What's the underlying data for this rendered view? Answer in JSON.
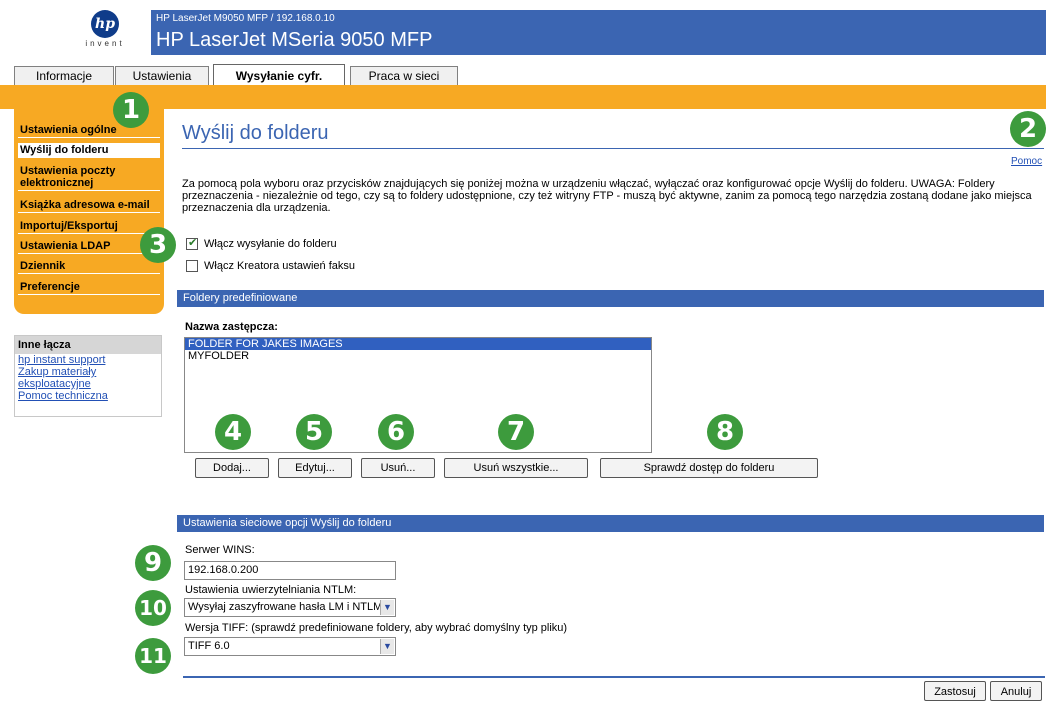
{
  "header": {
    "logo_text": "invent",
    "device_small": "HP LaserJet M9050 MFP / 192.168.0.10",
    "device_title": "HP LaserJet MSeria 9050 MFP"
  },
  "tabs": [
    {
      "label": "Informacje"
    },
    {
      "label": "Ustawienia"
    },
    {
      "label": "Wysyłanie cyfr."
    },
    {
      "label": "Praca w sieci"
    }
  ],
  "sidebar": {
    "items": [
      {
        "label": "Ustawienia ogólne"
      },
      {
        "label": "Wyślij do folderu"
      },
      {
        "label": "Ustawienia poczty elektronicznej"
      },
      {
        "label": "Książka adresowa e-mail"
      },
      {
        "label": "Importuj/Eksportuj"
      },
      {
        "label": "Ustawienia LDAP"
      },
      {
        "label": "Dziennik"
      },
      {
        "label": "Preferencje"
      }
    ]
  },
  "links": {
    "title": "Inne łącza",
    "items": [
      {
        "label": "hp instant support"
      },
      {
        "label": "Zakup materiały eksploatacyjne"
      },
      {
        "label": "Pomoc techniczna"
      }
    ]
  },
  "main": {
    "title": "Wyślij do folderu",
    "help": "Pomoc",
    "description": "Za pomocą pola wyboru oraz przycisków znajdujących się poniżej można w urządzeniu włączać, wyłączać oraz konfigurować opcje Wyślij do folderu. UWAGA: Foldery przeznaczenia - niezależnie od tego, czy są to foldery udostępnione, czy też witryny FTP - muszą być aktywne, zanim za pomocą tego narzędzia zostaną dodane jako miejsca przeznaczenia dla urządzenia.",
    "checkbox_folder": "Włącz wysyłanie do folderu",
    "checkbox_folder_checked": true,
    "checkbox_fax": "Włącz Kreatora ustawień faksu",
    "checkbox_fax_checked": false
  },
  "predefined": {
    "section_title": "Foldery predefiniowane",
    "list_label": "Nazwa zastępcza:",
    "items": [
      {
        "label": "FOLDER FOR JAKES IMAGES",
        "selected": true
      },
      {
        "label": "MYFOLDER",
        "selected": false
      }
    ],
    "buttons": {
      "add": "Dodaj...",
      "edit": "Edytuj...",
      "delete": "Usuń...",
      "delete_all": "Usuń wszystkie...",
      "check_access": "Sprawdź dostęp do folderu"
    }
  },
  "network": {
    "section_title": "Ustawienia sieciowe opcji Wyślij do folderu",
    "wins_label": "Serwer WINS:",
    "wins_value": "192.168.0.200",
    "ntlm_label": "Ustawienia uwierzytelniania NTLM:",
    "ntlm_value": "Wysyłaj zaszyfrowane hasła LM i NTLM",
    "tiff_label": "Wersja TIFF: (sprawdź predefiniowane foldery, aby wybrać domyślny typ pliku)",
    "tiff_value": "TIFF 6.0"
  },
  "footer": {
    "apply": "Zastosuj",
    "cancel": "Anuluj"
  },
  "callouts": [
    "1",
    "2",
    "3",
    "4",
    "5",
    "6",
    "7",
    "8",
    "9",
    "10",
    "11"
  ],
  "colors": {
    "header_blue": "#3b65b2",
    "orange": "#f7a923",
    "callout_green": "#3d9b3d",
    "link_blue": "#2250b5"
  },
  "icons": {
    "logo": "hp-logo-icon",
    "dropdown": "chevron-down-icon",
    "checkmark": "checkmark-icon"
  }
}
